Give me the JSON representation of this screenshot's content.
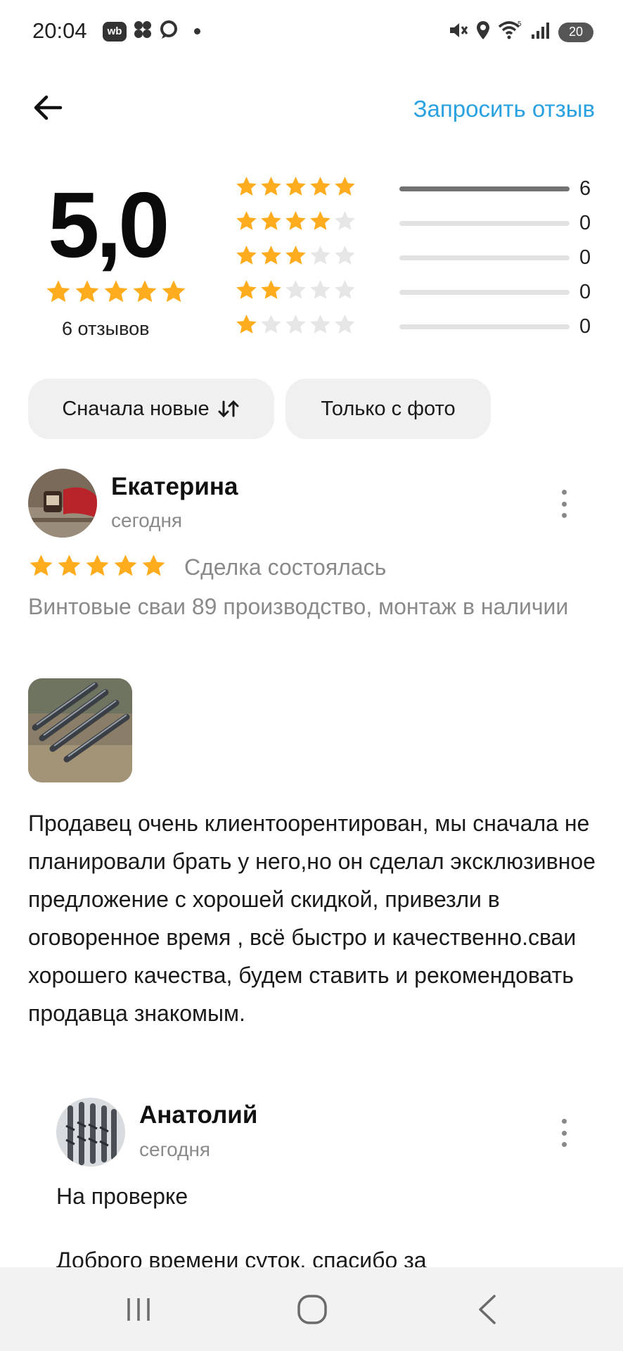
{
  "status_bar": {
    "time": "20:04",
    "left_icons": [
      "wb-icon",
      "clover-icon",
      "chat-icon",
      "dot-icon"
    ],
    "wb_label": "wb",
    "right_icons": [
      "mute-icon",
      "location-icon",
      "wifi-icon",
      "signal-icon"
    ],
    "battery": "20"
  },
  "header": {
    "back_icon": "arrow-left-icon",
    "request_label": "Запросить отзыв"
  },
  "summary": {
    "rating": "5,0",
    "stars": 5,
    "reviews_count": "6 отзывов",
    "distribution": [
      {
        "stars": 5,
        "count": "6",
        "fraction": 1.0
      },
      {
        "stars": 4,
        "count": "0",
        "fraction": 0
      },
      {
        "stars": 3,
        "count": "0",
        "fraction": 0
      },
      {
        "stars": 2,
        "count": "0",
        "fraction": 0
      },
      {
        "stars": 1,
        "count": "0",
        "fraction": 0
      }
    ]
  },
  "filters": {
    "sort_label": "Сначала новые",
    "sort_icon": "sort-arrows-icon",
    "photo_label": "Только с фото"
  },
  "review": {
    "author": "Екатерина",
    "date": "сегодня",
    "stars": 5,
    "deal": "Сделка состоялась",
    "product": "Винтовые сваи 89 производство, монтаж в наличии",
    "text": "Продавец очень клиентоорентирован, мы сначала не планировали брать у него,но он сделал эксклюзивное предложение с хорошей скидкой, привезли в оговоренное время , всё быстро и качественно.сваи хорошего качества, будем ставить и рекомендовать продавца знакомым."
  },
  "reply": {
    "author": "Анатолий",
    "date": "сегодня",
    "status": "На проверке",
    "text": "Доброго времени суток, спасибо за"
  },
  "colors": {
    "accent": "#2aa1e0",
    "star": "#ffac1e",
    "star_empty": "#e6e6e6"
  },
  "nav": [
    "recent-apps-icon",
    "home-icon",
    "back-icon"
  ]
}
